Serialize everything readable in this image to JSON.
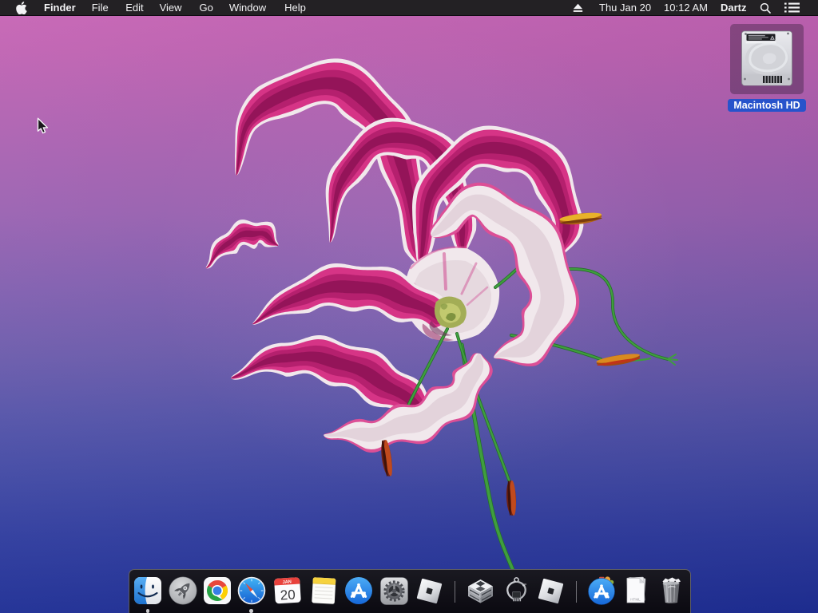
{
  "menu_bar": {
    "apple_icon": "apple-logo",
    "menus": [
      {
        "label": "Finder",
        "bold": true
      },
      {
        "label": "File"
      },
      {
        "label": "Edit"
      },
      {
        "label": "View"
      },
      {
        "label": "Go"
      },
      {
        "label": "Window"
      },
      {
        "label": "Help"
      }
    ],
    "status": {
      "eject_icon": "eject",
      "date": "Thu Jan 20",
      "time": "10:12 AM",
      "user": "Dartz",
      "search_icon": "magnifier",
      "notification_icon": "notification-list"
    }
  },
  "desktop": {
    "icons": [
      {
        "label": "Macintosh HD",
        "selected": true,
        "icon": "internal-hard-drive"
      }
    ],
    "selection_label_color": "#2a59d0"
  },
  "dock": {
    "items": [
      {
        "name": "finder",
        "running": true
      },
      {
        "name": "launchpad",
        "running": false
      },
      {
        "name": "google-chrome",
        "running": false
      },
      {
        "name": "safari",
        "running": true
      },
      {
        "name": "calendar",
        "running": false,
        "badge_month": "JAN",
        "badge_day": "20"
      },
      {
        "name": "notes",
        "running": false
      },
      {
        "name": "app-store",
        "running": false
      },
      {
        "name": "system-preferences",
        "running": false
      },
      {
        "name": "roblox-studio",
        "running": false
      },
      {
        "name": "separator"
      },
      {
        "name": "internal-drive",
        "running": false
      },
      {
        "name": "chip-extractor-tool",
        "running": false
      },
      {
        "name": "roblox",
        "running": false
      },
      {
        "name": "separator"
      },
      {
        "name": "applications-stack"
      },
      {
        "name": "downloads-stack",
        "file_label": "HTML"
      },
      {
        "name": "trash",
        "full": true
      }
    ]
  }
}
